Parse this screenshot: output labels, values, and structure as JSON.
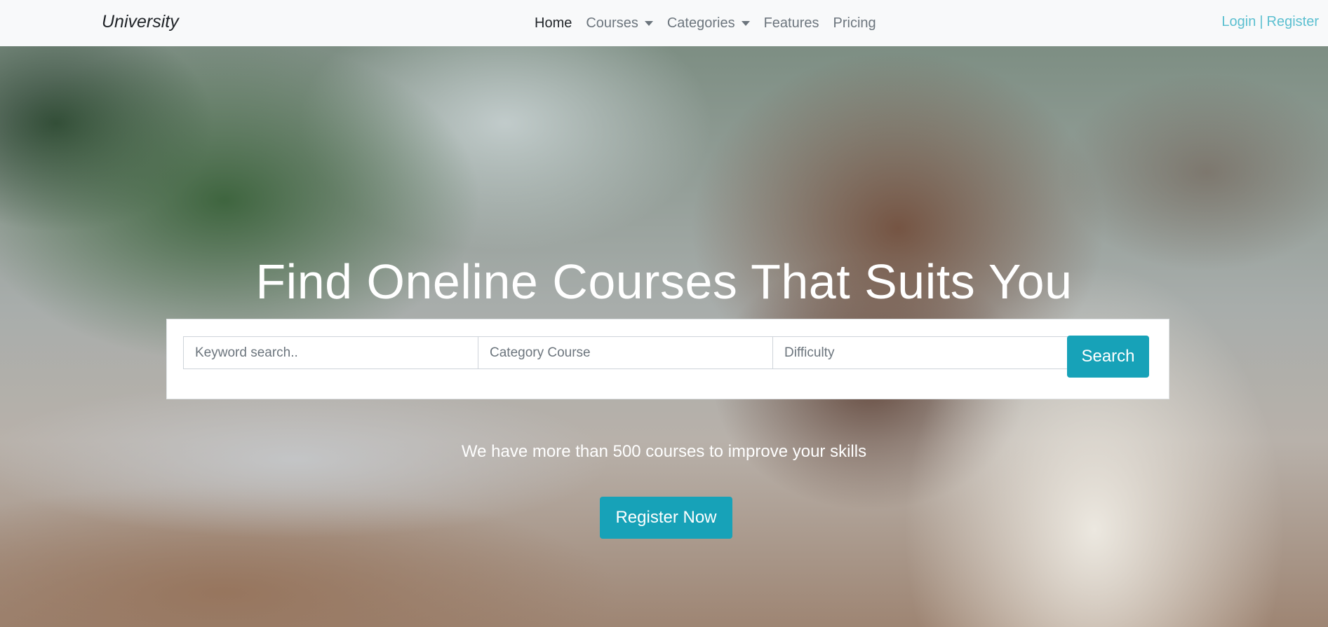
{
  "navbar": {
    "brand": "University",
    "links": [
      {
        "label": "Home",
        "active": true
      },
      {
        "label": "Courses",
        "dropdown": true
      },
      {
        "label": "Categories",
        "dropdown": true
      },
      {
        "label": "Features"
      },
      {
        "label": "Pricing"
      }
    ],
    "auth": {
      "login": "Login",
      "separator": "|",
      "register": "Register"
    }
  },
  "hero": {
    "title": "Find Oneline Courses That Suits You",
    "search": {
      "keyword_placeholder": "Keyword search..",
      "category_placeholder": "Category Course",
      "difficulty_placeholder": "Difficulty",
      "button_label": "Search"
    },
    "tagline": "We have more than 500 courses to improve your skills",
    "register_button": "Register Now"
  },
  "colors": {
    "accent": "#17a2b8",
    "auth_link": "#5bbfd0",
    "navbar_bg": "#f8f9fa"
  }
}
